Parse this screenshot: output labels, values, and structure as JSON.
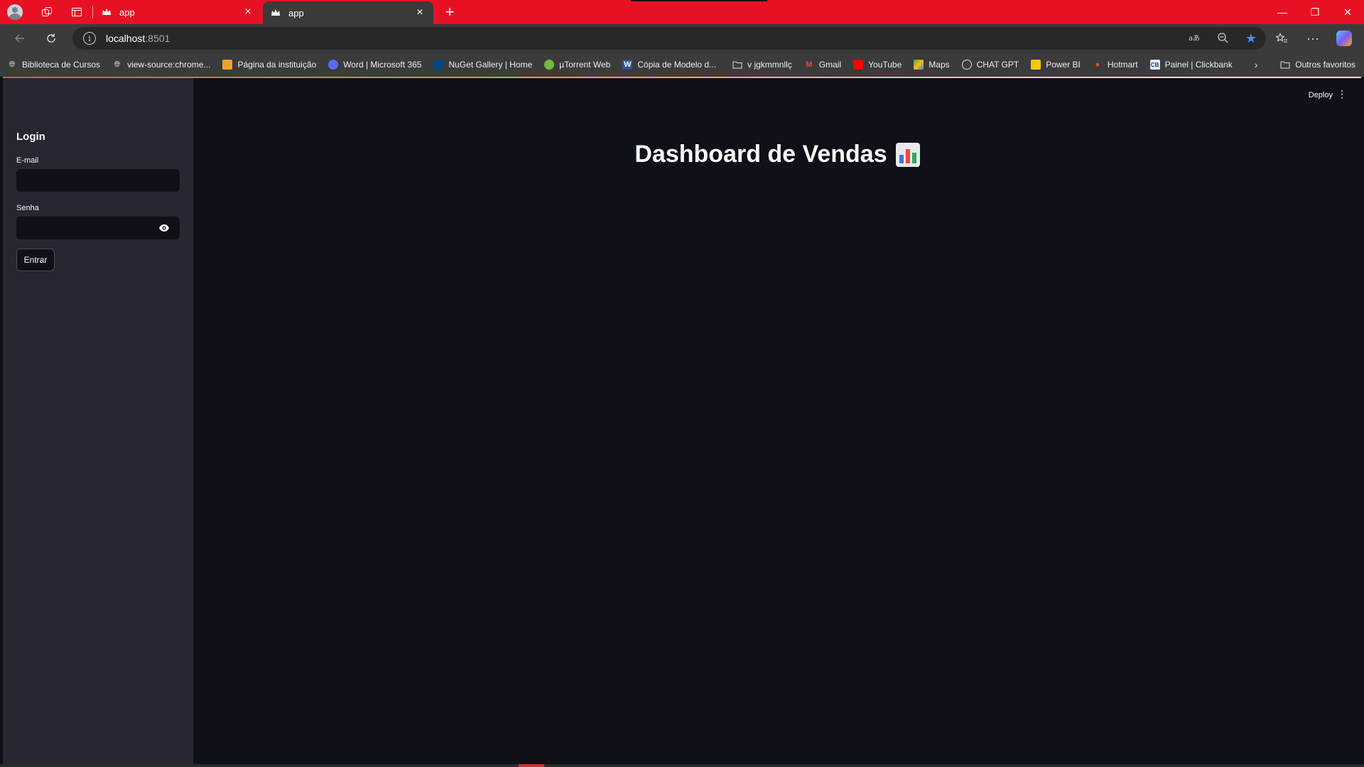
{
  "browser": {
    "tabs": [
      {
        "title": "app",
        "close": "×"
      },
      {
        "title": "app",
        "close": "×"
      }
    ],
    "new_tab": "+",
    "window_controls": {
      "minimize": "—",
      "restore": "❐",
      "close": "✕"
    },
    "address": {
      "host": "localhost",
      "port": ":8501"
    },
    "bookmarks": [
      {
        "label": "Biblioteca de Cursos",
        "icon": "globe-icon"
      },
      {
        "label": "view-source:chrome...",
        "icon": "globe-icon"
      },
      {
        "label": "Página da instituição",
        "icon": "pencil-icon"
      },
      {
        "label": "Word | Microsoft 365",
        "icon": "microsoft-icon"
      },
      {
        "label": "NuGet Gallery | Home",
        "icon": "nuget-icon"
      },
      {
        "label": "µTorrent Web",
        "icon": "utorrent-icon"
      },
      {
        "label": "Cópia de Modelo d...",
        "icon": "word-icon"
      },
      {
        "label": "v jgkmmnllç",
        "icon": "folder-icon"
      },
      {
        "label": "Gmail",
        "icon": "gmail-icon"
      },
      {
        "label": "YouTube",
        "icon": "youtube-icon"
      },
      {
        "label": "Maps",
        "icon": "maps-icon"
      },
      {
        "label": "CHAT GPT",
        "icon": "openai-icon"
      },
      {
        "label": "Power BI",
        "icon": "powerbi-icon"
      },
      {
        "label": "Hotmart",
        "icon": "hotmart-icon"
      },
      {
        "label": "Painel | Clickbank",
        "icon": "clickbank-icon"
      }
    ],
    "bookmarks_more": "›",
    "other_favorites": "Outros favoritos"
  },
  "sidebar": {
    "title": "Login",
    "email_label": "E-mail",
    "email_value": "",
    "password_label": "Senha",
    "password_value": "",
    "submit_label": "Entrar"
  },
  "header": {
    "deploy_label": "Deploy",
    "menu": "⋮"
  },
  "main": {
    "title": "Dashboard de Vendas"
  },
  "colors": {
    "browser_accent": "#e81123",
    "sidebar_bg": "#262730",
    "page_bg": "#0e1117",
    "text": "#fafafa"
  }
}
